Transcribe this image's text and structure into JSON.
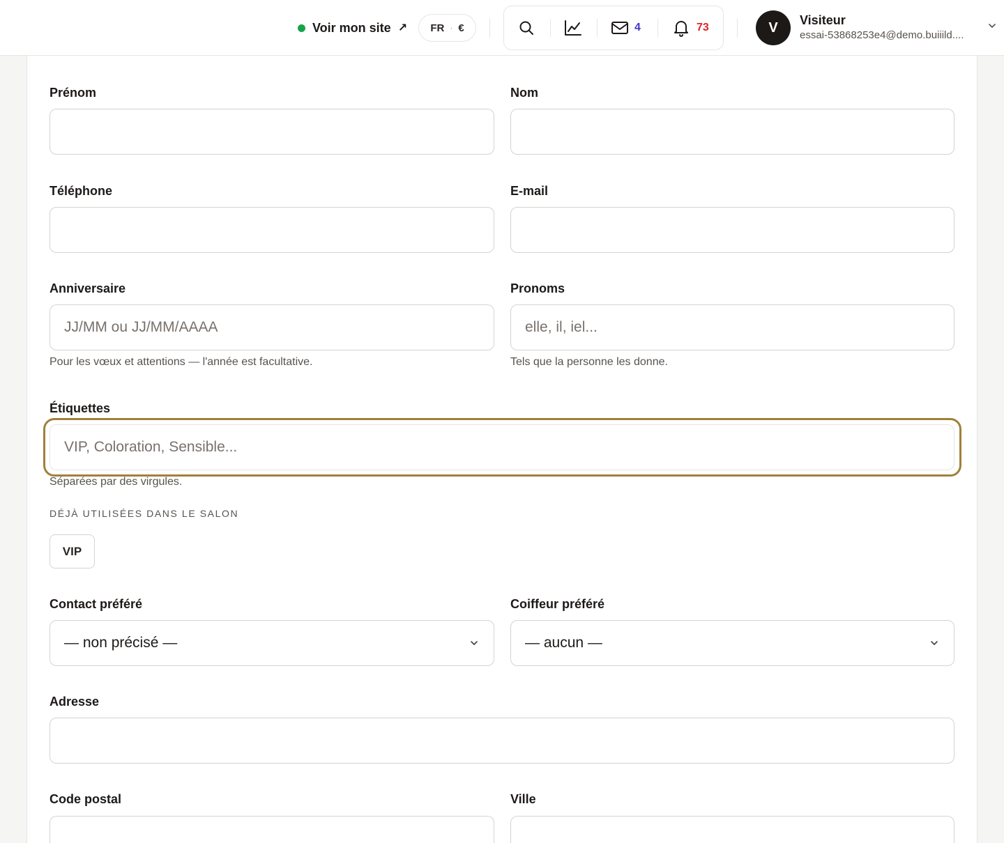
{
  "header": {
    "site_link": "Voir mon site",
    "site_link_arrow": "↗",
    "site_status_color": "#16a34a",
    "locale_lang": "FR",
    "locale_sep": "·",
    "locale_currency": "€",
    "messages_count": "4",
    "notifications_count": "73",
    "icons": [
      "search-icon",
      "chart-icon",
      "mail-icon",
      "bell-icon",
      "chevron-down-icon"
    ]
  },
  "user": {
    "initial": "V",
    "name": "Visiteur",
    "email": "essai-53868253e4@demo.buiiild...."
  },
  "form": {
    "prenom": {
      "label": "Prénom",
      "value": ""
    },
    "nom": {
      "label": "Nom",
      "value": ""
    },
    "telephone": {
      "label": "Téléphone",
      "value": ""
    },
    "email": {
      "label": "E-mail",
      "value": ""
    },
    "anniversaire": {
      "label": "Anniversaire",
      "placeholder": "JJ/MM ou JJ/MM/AAAA",
      "hint": "Pour les vœux et attentions — l'année est facultative."
    },
    "pronoms": {
      "label": "Pronoms",
      "placeholder": "elle, il, iel...",
      "hint": "Tels que la personne les donne."
    },
    "etiquettes": {
      "label": "Étiquettes",
      "placeholder": "VIP, Coloration, Sensible...",
      "hint": "Séparées par des virgules.",
      "used_caption": "DÉJÀ UTILISÉES DANS LE SALON",
      "used_tags": [
        "VIP"
      ]
    },
    "contact_prefere": {
      "label": "Contact préféré",
      "selected": "— non précisé —"
    },
    "coiffeur_prefere": {
      "label": "Coiffeur préféré",
      "selected": "— aucun —"
    },
    "adresse": {
      "label": "Adresse",
      "value": ""
    },
    "code_postal": {
      "label": "Code postal",
      "value": ""
    },
    "ville": {
      "label": "Ville",
      "value": ""
    }
  },
  "colors": {
    "focus_ring": "#a0803a",
    "messages_badge": "#4338ca",
    "notifications_badge": "#dc2626"
  }
}
